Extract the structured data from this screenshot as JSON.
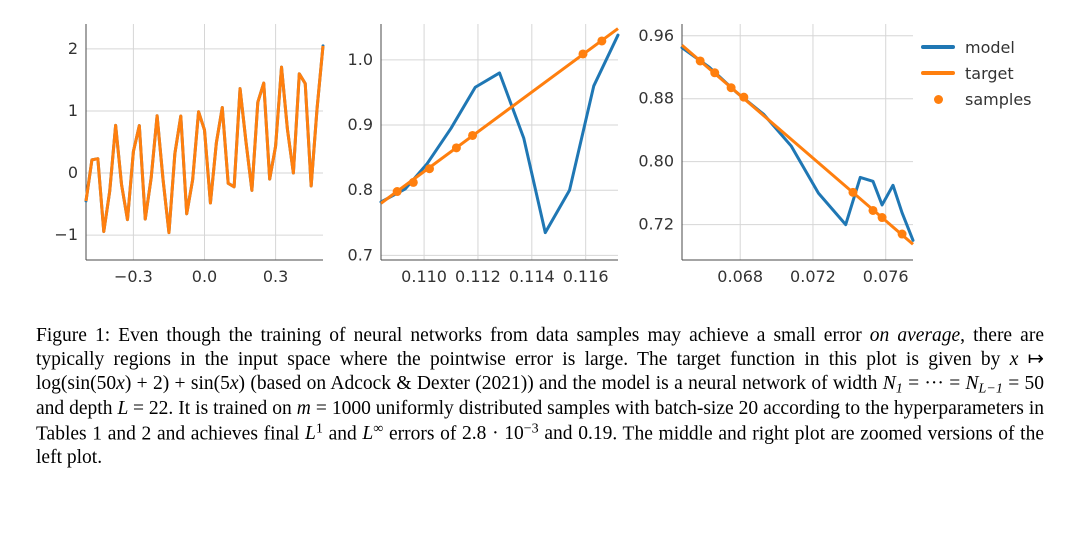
{
  "legend": {
    "model": {
      "label": "model",
      "color": "#1f77b4"
    },
    "target": {
      "label": "target",
      "color": "#ff7f0e"
    },
    "samples": {
      "label": "samples",
      "color": "#ff7f0e"
    }
  },
  "caption": {
    "lead": "Figure 1: Even though the training of neural networks from data samples may achieve a small error ",
    "em1": "on average",
    "mid1": ", there are typically regions in the input space where the pointwise error is large. The target function in this plot is given by ",
    "formula_plain": "x ↦ log(sin(50x) + 2) + sin(5x)",
    "mid2": " (based on Adcock & Dexter (2021)) and the model is a neural network of width ",
    "width_plain": "N₁ = ··· = N_{L−1} = 50",
    "mid3": " and depth ",
    "depth_plain": "L = 22",
    "mid4": ". It is trained on ",
    "m_plain": "m = 1000",
    "mid5": " uniformly distributed samples with batch-size 20 according to the hyperparameters in Tables 1 and 2 and achieves final ",
    "L1_plain": "L¹",
    "mid6": " and ",
    "Linf_plain": "L∞",
    "mid7": " errors of ",
    "err_plain": "2.8 · 10⁻³ and 0.19",
    "tail": ". The middle and right plot are zoomed versions of the left plot."
  },
  "chart_data": [
    {
      "type": "line",
      "title": "",
      "xlabel": "",
      "ylabel": "",
      "xlim": [
        -0.5,
        0.5
      ],
      "ylim": [
        -1.4,
        2.4
      ],
      "xticks": [
        -0.3,
        0.0,
        0.3
      ],
      "yticks": [
        -1,
        0,
        1,
        2
      ],
      "series": [
        {
          "name": "target",
          "x": [
            -0.5,
            -0.475,
            -0.45,
            -0.425,
            -0.4,
            -0.375,
            -0.35,
            -0.325,
            -0.3,
            -0.275,
            -0.25,
            -0.225,
            -0.2,
            -0.175,
            -0.15,
            -0.125,
            -0.1,
            -0.075,
            -0.05,
            -0.025,
            0.0,
            0.025,
            0.05,
            0.075,
            0.1,
            0.125,
            0.15,
            0.175,
            0.2,
            0.225,
            0.25,
            0.275,
            0.3,
            0.325,
            0.35,
            0.375,
            0.4,
            0.425,
            0.45,
            0.475,
            0.5
          ],
          "y": [
            -0.45,
            0.213,
            0.231,
            -0.942,
            -0.294,
            0.768,
            -0.187,
            -0.75,
            0.348,
            0.764,
            -0.741,
            -0.076,
            0.922,
            -0.103,
            -0.959,
            0.315,
            0.918,
            -0.656,
            -0.108,
            0.987,
            0.693,
            -0.482,
            0.486,
            1.056,
            -0.166,
            -0.221,
            1.359,
            0.503,
            -0.279,
            1.141,
            1.449,
            -0.097,
            0.433,
            1.706,
            0.702,
            0.001,
            1.598,
            1.441,
            -0.208,
            1.04,
            2.047
          ]
        },
        {
          "name": "model",
          "x": [
            -0.5,
            -0.475,
            -0.45,
            -0.425,
            -0.4,
            -0.375,
            -0.35,
            -0.325,
            -0.3,
            -0.275,
            -0.25,
            -0.225,
            -0.2,
            -0.175,
            -0.15,
            -0.125,
            -0.1,
            -0.075,
            -0.05,
            -0.025,
            0.0,
            0.025,
            0.05,
            0.075,
            0.1,
            0.125,
            0.15,
            0.175,
            0.2,
            0.225,
            0.25,
            0.275,
            0.3,
            0.325,
            0.35,
            0.375,
            0.4,
            0.425,
            0.45,
            0.475,
            0.5
          ],
          "y": [
            -0.45,
            0.213,
            0.231,
            -0.942,
            -0.294,
            0.768,
            -0.187,
            -0.75,
            0.348,
            0.764,
            -0.741,
            -0.076,
            0.922,
            -0.103,
            -0.959,
            0.315,
            0.918,
            -0.656,
            -0.108,
            0.987,
            0.693,
            -0.482,
            0.486,
            1.056,
            -0.166,
            -0.221,
            1.359,
            0.503,
            -0.279,
            1.141,
            1.449,
            -0.097,
            0.433,
            1.706,
            0.702,
            0.001,
            1.598,
            1.441,
            -0.208,
            1.04,
            2.047
          ]
        }
      ]
    },
    {
      "type": "line",
      "title": "",
      "xlabel": "",
      "ylabel": "",
      "xlim": [
        0.1084,
        0.1172
      ],
      "ylim": [
        0.693,
        1.055
      ],
      "xticks": [
        0.11,
        0.112,
        0.114,
        0.116
      ],
      "yticks": [
        0.7,
        0.8,
        0.9,
        1.0
      ],
      "series": [
        {
          "name": "target",
          "x": [
            0.1084,
            0.1172
          ],
          "y": [
            0.78,
            1.048
          ]
        },
        {
          "name": "model",
          "x": [
            0.1084,
            0.1093,
            0.1101,
            0.111,
            0.1119,
            0.1128,
            0.1137,
            0.1145,
            0.1154,
            0.1163,
            0.1172
          ],
          "y": [
            0.782,
            0.802,
            0.84,
            0.895,
            0.958,
            0.98,
            0.88,
            0.735,
            0.8,
            0.96,
            1.038
          ]
        }
      ],
      "samples": {
        "x": [
          0.109,
          0.1096,
          0.1102,
          0.1112,
          0.1118,
          0.1159,
          0.1166
        ],
        "y": [
          0.798,
          0.812,
          0.833,
          0.865,
          0.884,
          1.009,
          1.029
        ]
      }
    },
    {
      "type": "line",
      "title": "",
      "xlabel": "",
      "ylabel": "",
      "xlim": [
        0.0648,
        0.0775
      ],
      "ylim": [
        0.675,
        0.975
      ],
      "xticks": [
        0.068,
        0.072,
        0.076
      ],
      "yticks": [
        0.72,
        0.8,
        0.88,
        0.96
      ],
      "series": [
        {
          "name": "target",
          "x": [
            0.0648,
            0.0775
          ],
          "y": [
            0.948,
            0.695
          ]
        },
        {
          "name": "model",
          "x": [
            0.0648,
            0.0663,
            0.0678,
            0.0693,
            0.0708,
            0.0723,
            0.0738,
            0.0746,
            0.0753,
            0.0758,
            0.0764,
            0.0769,
            0.0775
          ],
          "y": [
            0.945,
            0.92,
            0.888,
            0.86,
            0.82,
            0.76,
            0.72,
            0.78,
            0.775,
            0.745,
            0.77,
            0.735,
            0.7
          ]
        }
      ],
      "samples": {
        "x": [
          0.0658,
          0.0666,
          0.0675,
          0.0682,
          0.0742,
          0.0753,
          0.0758,
          0.0769
        ],
        "y": [
          0.928,
          0.913,
          0.894,
          0.882,
          0.761,
          0.738,
          0.729,
          0.708
        ]
      }
    }
  ]
}
